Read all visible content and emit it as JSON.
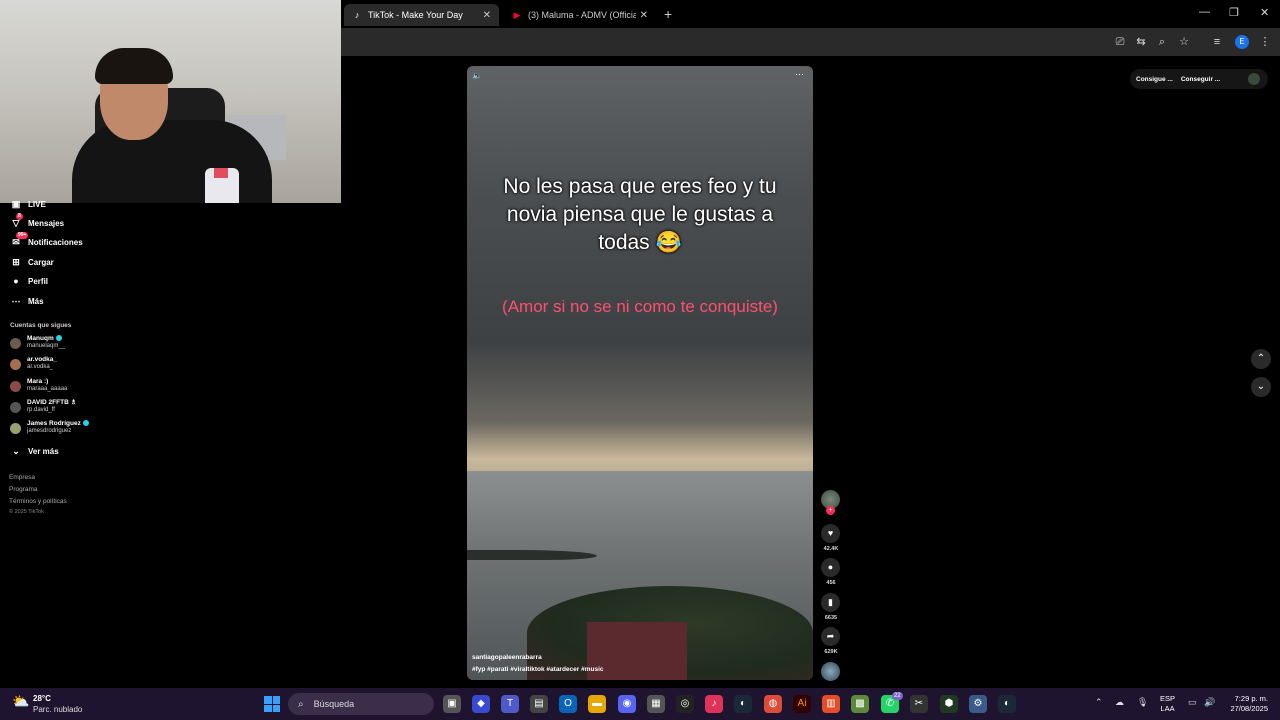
{
  "browser": {
    "tabs": [
      {
        "title": "TikTok - Make Your Day",
        "icon": "tiktok-icon"
      },
      {
        "title": "(3) Maluma - ADMV (Official Vi",
        "icon": "youtube-icon"
      }
    ],
    "new_tab": "+",
    "profile_letter": "E"
  },
  "sidebar": {
    "items": [
      {
        "label": "LIVE",
        "icon": "live-icon"
      },
      {
        "label": "Mensajes",
        "icon": "messages-icon",
        "badge": "8"
      },
      {
        "label": "Notificaciones",
        "icon": "notifications-icon",
        "badge": "99+"
      },
      {
        "label": "Cargar",
        "icon": "upload-icon"
      },
      {
        "label": "Perfil",
        "icon": "profile-icon"
      },
      {
        "label": "Más",
        "icon": "more-icon"
      }
    ],
    "following_header": "Cuentas que sigues",
    "following": [
      {
        "name": "Manuqm",
        "handle": "manuelaqm__",
        "verified": true
      },
      {
        "name": "ar.vodka_",
        "handle": "ar.vodka_",
        "verified": false
      },
      {
        "name": "Mara :)",
        "handle": "maraaa_aaaaa",
        "verified": false
      },
      {
        "name": "DAVID 2FFTB ♗",
        "handle": "rp.david_ff",
        "verified": false
      },
      {
        "name": "James Rodríguez",
        "handle": "jamesdrodriguez",
        "verified": true
      }
    ],
    "see_more": "Ver más",
    "footer": [
      "Empresa",
      "Programa",
      "Términos y políticas"
    ],
    "copyright": "© 2025 TikTok"
  },
  "video": {
    "caption": "No les pasa que eres feo y tu novia piensa que le gustas a todas 😂",
    "subcaption": "(Amor si no se ni como te conquiste)",
    "author": "santiagopaleenrabarra",
    "tags": "#fyp #parati #viraltiktok #atardecer #music",
    "likes": "42.4K",
    "comments": "456",
    "saves": "6635",
    "shares": "629K"
  },
  "right_panel": {
    "pill_1": "Consigue ...",
    "pill_2": "Conseguir ..."
  },
  "taskbar": {
    "weather_temp": "28°C",
    "weather_desc": "Parc. nublado",
    "search_label": "Búsqueda",
    "lang_1": "ESP",
    "lang_2": "LAA",
    "time": "7:29 p. m.",
    "date": "27/08/2025",
    "whatsapp_badge": "22"
  },
  "colors": {
    "accent": "#fe2c55",
    "caption_pink": "#ff4f6f",
    "taskbar": "#1f1430"
  }
}
